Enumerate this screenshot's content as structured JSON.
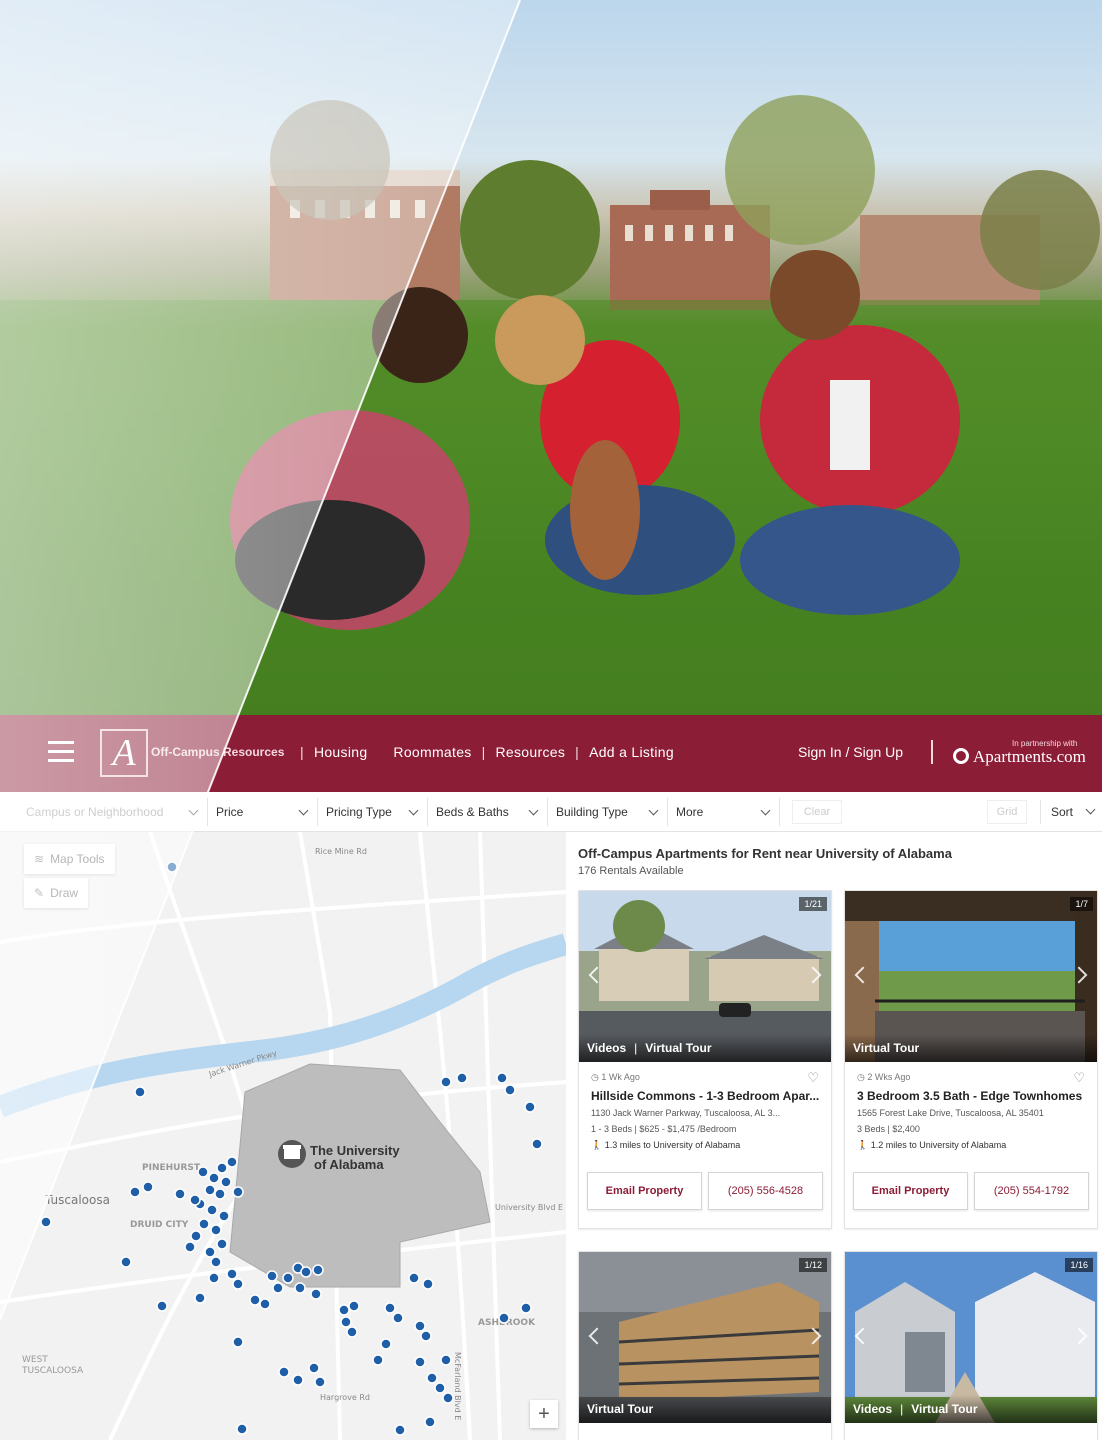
{
  "nav": {
    "brand": "Off-Campus Resources",
    "sep": "|",
    "links": [
      "Housing",
      "Roommates",
      "Resources",
      "Add a Listing"
    ],
    "signin": "Sign In / Sign Up",
    "partner_note": "In partnership with",
    "partner_brand": "Apartments.com",
    "logo_glyph": "A"
  },
  "filters": {
    "campus": "Campus or Neighborhood",
    "price": "Price",
    "pricing_type": "Pricing Type",
    "beds_baths": "Beds & Baths",
    "building_type": "Building Type",
    "more": "More",
    "clear": "Clear",
    "grid": "Grid",
    "sort": "Sort"
  },
  "map": {
    "tools_label": "Map Tools",
    "draw_label": "Draw",
    "campus_name_line1": "The University",
    "campus_name_line2": "of Alabama",
    "zoom_in": "+",
    "place_labels": [
      "PINEHURST",
      "DRUID CITY",
      "Tuscaloosa",
      "WEST TUSCALOOSA",
      "ASHBROOK"
    ],
    "road_labels": [
      "Rice Mine Rd",
      "Jack Warner Pkwy",
      "University Blvd E",
      "McFarland Blvd E",
      "Hargrove Rd"
    ]
  },
  "results": {
    "title": "Off-Campus Apartments for Rent near University of Alabama",
    "count": "176 Rentals Available"
  },
  "listings": [
    {
      "counter": "1/21",
      "tours": [
        "Videos",
        "Virtual Tour"
      ],
      "updated": "1 Wk Ago",
      "name": "Hillside Commons - 1-3 Bedroom Apar...",
      "address": "1130 Jack Warner Parkway, Tuscaloosa, AL 3...",
      "meta": "1 - 3 Beds | $625 - $1,475 /Bedroom",
      "distance": "1.3 miles to University of Alabama",
      "email_label": "Email Property",
      "phone": "(205) 556-4528"
    },
    {
      "counter": "1/7",
      "tours": [
        "Virtual Tour"
      ],
      "updated": "2 Wks Ago",
      "name": "3 Bedroom 3.5 Bath - Edge Townhomes",
      "address": "1565 Forest Lake Drive, Tuscaloosa, AL 35401",
      "meta": "3 Beds | $2,400",
      "distance": "1.2 miles to University of Alabama",
      "email_label": "Email Property",
      "phone": "(205) 554-1792"
    },
    {
      "counter": "1/12",
      "tours": [
        "Virtual Tour"
      ]
    },
    {
      "counter": "1/16",
      "tours": [
        "Videos",
        "Virtual Tour"
      ]
    }
  ],
  "colors": {
    "brand": "#8c1d36",
    "map_pin": "#1f5fa8",
    "campus_area": "#bdbdbd"
  }
}
